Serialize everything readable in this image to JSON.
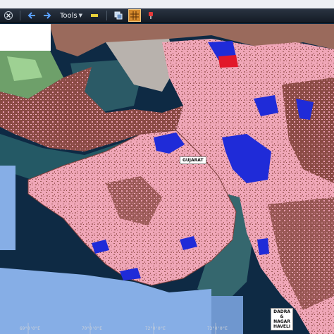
{
  "toolbar": {
    "tools_label": "Tools",
    "icons": [
      "close-icon",
      "back-arrow-icon",
      "forward-arrow-icon",
      "pencil-icon",
      "layers-icon",
      "grid-icon",
      "pin-icon"
    ]
  },
  "map": {
    "labels": {
      "gujarat": "GUJARAT",
      "dadra_line1": "DADRA",
      "dadra_line2": "&",
      "dadra_line3": "NAGAR",
      "dadra_line4": "HAVELI"
    },
    "graticule": [
      "69°0'0\"E",
      "70°0'0\"E",
      "72°0'0\"E",
      "73°0'0\"E"
    ]
  },
  "colors": {
    "land_pink": "#f0a7b8",
    "land_brown": "#8a4a44",
    "water_blue": "#1f2bd8",
    "sea_dark": "#0e2a44",
    "sea_teal": "#2c6a70",
    "nodata_blue": "#86aee6"
  }
}
